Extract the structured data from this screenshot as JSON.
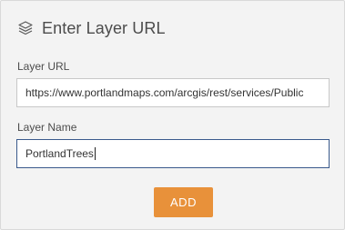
{
  "header": {
    "title": "Enter Layer URL",
    "icon": "layers-icon"
  },
  "form": {
    "url_label": "Layer URL",
    "url_value": "https://www.portlandmaps.com/arcgis/rest/services/Public",
    "name_label": "Layer Name",
    "name_value": "PortlandTrees",
    "add_label": "ADD"
  },
  "colors": {
    "panel_bg": "#f3f3f3",
    "accent_button": "#e8913a",
    "focused_border": "#3a5a8c"
  }
}
